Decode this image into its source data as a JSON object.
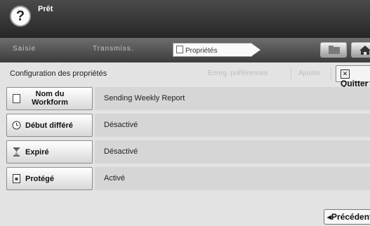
{
  "header": {
    "help_label": "?",
    "status": "Prêt"
  },
  "tabs": {
    "saisie": "Saisie",
    "transmiss": "Transmiss.",
    "proprietes": "Propriétés"
  },
  "toolbar": {
    "title": "Configuration des propriétés",
    "faded_1": "Enreg. préférences",
    "faded_2": "Ajouter",
    "quit_label": "Quitter"
  },
  "properties": [
    {
      "label": "Nom du Workform",
      "value": "Sending Weekly Report",
      "icon": "document-icon"
    },
    {
      "label": "Début différé",
      "value": "Désactivé",
      "icon": "clock-icon"
    },
    {
      "label": "Expiré",
      "value": "Désactivé",
      "icon": "hourglass-icon"
    },
    {
      "label": "Protégé",
      "value": "Activé",
      "icon": "lock-icon"
    }
  ],
  "footer": {
    "prev_label": "Précédent"
  }
}
